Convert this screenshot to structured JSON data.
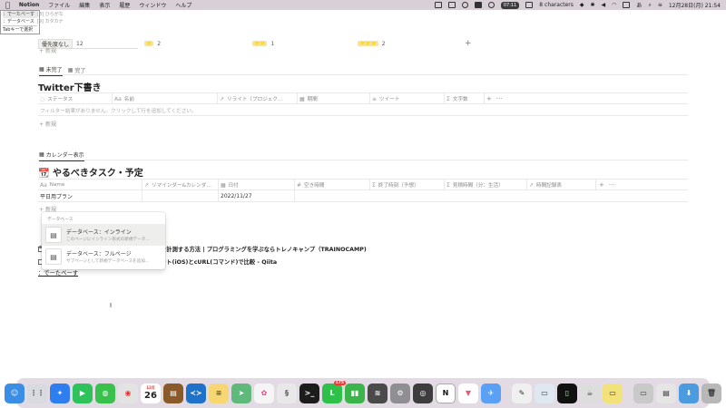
{
  "menubar": {
    "app_name": "Notion",
    "items": [
      "ファイル",
      "編集",
      "表示",
      "履歴",
      "ウィンドウ",
      "ヘルプ"
    ],
    "time_center": "07:11",
    "char_count": "8 characters",
    "datetime": "12月28日(月) 21:54"
  },
  "hint": {
    "row1_label": "：でーたべーす",
    "row1_key": "[8] ひらがな",
    "row2_label": "：データベース",
    "row2_key": "[9] カタカナ",
    "tab_hint": "Tabキーで選択"
  },
  "board": {
    "first_group": "優先度なし",
    "first_count": "12",
    "groups": [
      {
        "tag": "⭐",
        "count": "2"
      },
      {
        "tag": "⭐⭐",
        "count": "1"
      },
      {
        "tag": "⭐⭐⭐",
        "count": "2"
      }
    ],
    "add": "+"
  },
  "new_label": "新規",
  "tabs1": [
    {
      "label": "未完了",
      "active": true
    },
    {
      "label": "完了",
      "active": false
    }
  ],
  "db1": {
    "title": "Twitter下書き",
    "columns": [
      "ステータス",
      "名前",
      "リライト（プロジェク…",
      "期間",
      "ツイート",
      "文字数"
    ],
    "empty_text": "フィルター結果がありません。クリックして行を追加してください。"
  },
  "tabs2": [
    {
      "label": "カレンダー表示",
      "active": true
    }
  ],
  "db2": {
    "title": "やるべきタスク・予定",
    "columns": [
      "Name",
      "リマインダー&カレンダ…",
      "日付",
      "空き時間",
      "終了時刻（予想）",
      "見積時間（分：生活）",
      "時間記録表"
    ],
    "row_name": "平日用プラン",
    "row_date": "2022/11/27"
  },
  "popup": {
    "header": "データベース",
    "items": [
      {
        "title": "データベース：インライン",
        "desc": "このページにインライン形式の新規データ…"
      },
      {
        "title": "データベース：フルページ",
        "desc": "サブページとして新規データベースを追加…"
      }
    ]
  },
  "links": [
    "を計測する方法 | プログラミングを学ぶならトレノキャンプ（TRAINOCAMP)",
    "ット(iOS)とcURL(コマンド)で比較 - Qiita"
  ],
  "page_link": "：でーたべーす",
  "dock": {
    "calendar_day": "26",
    "calendar_month": "12月",
    "line_badge": "175"
  }
}
